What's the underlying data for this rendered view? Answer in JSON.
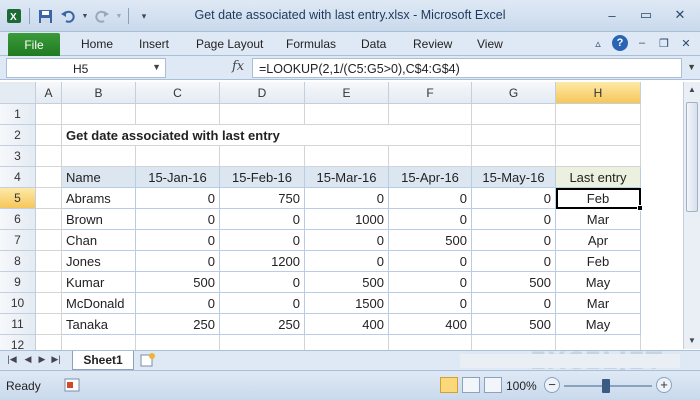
{
  "window": {
    "title": "Get date associated with last entry.xlsx - Microsoft Excel"
  },
  "ribbon": {
    "file": "File",
    "tabs": [
      "Home",
      "Insert",
      "Page Layout",
      "Formulas",
      "Data",
      "Review",
      "View"
    ]
  },
  "formula_bar": {
    "name_box": "H5",
    "fx_label": "fx",
    "formula": "=LOOKUP(2,1/(C5:G5>0),C$4:G$4)"
  },
  "columns": [
    "A",
    "B",
    "C",
    "D",
    "E",
    "F",
    "G",
    "H"
  ],
  "rows": [
    "1",
    "2",
    "3",
    "4",
    "5",
    "6",
    "7",
    "8",
    "9",
    "10",
    "11",
    "12"
  ],
  "sheet": {
    "title": "Get date associated with last entry",
    "header": [
      "Name",
      "15-Jan-16",
      "15-Feb-16",
      "15-Mar-16",
      "15-Apr-16",
      "15-May-16",
      "Last entry"
    ],
    "data": [
      [
        "Abrams",
        "0",
        "750",
        "0",
        "0",
        "0",
        "Feb"
      ],
      [
        "Brown",
        "0",
        "0",
        "1000",
        "0",
        "0",
        "Mar"
      ],
      [
        "Chan",
        "0",
        "0",
        "0",
        "500",
        "0",
        "Apr"
      ],
      [
        "Jones",
        "0",
        "1200",
        "0",
        "0",
        "0",
        "Feb"
      ],
      [
        "Kumar",
        "500",
        "0",
        "500",
        "0",
        "500",
        "May"
      ],
      [
        "McDonald",
        "0",
        "0",
        "1500",
        "0",
        "0",
        "Mar"
      ],
      [
        "Tanaka",
        "250",
        "250",
        "400",
        "400",
        "500",
        "May"
      ]
    ]
  },
  "sheet_tabs": {
    "active": "Sheet1"
  },
  "watermark": "EXCELJET",
  "status": {
    "ready": "Ready",
    "zoom": "100%"
  },
  "colors": {
    "active_cell_outline": "#000000",
    "table_header_fill": "#dce6f1",
    "last_entry_header_fill": "#ebf1de",
    "file_tab": "#2a8a2a"
  }
}
